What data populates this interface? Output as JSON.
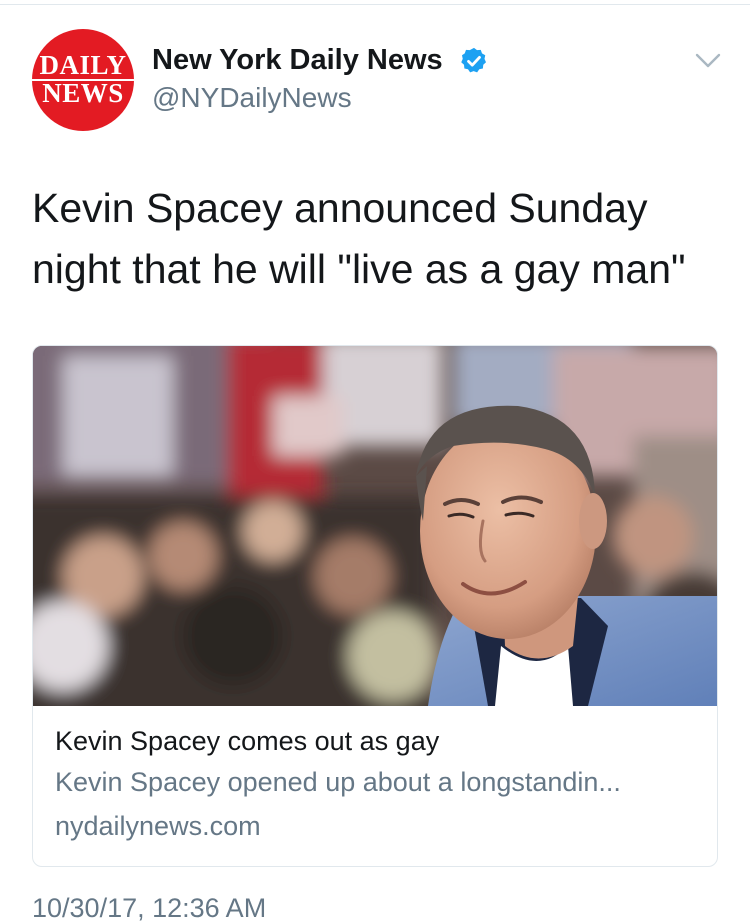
{
  "tweet": {
    "author": {
      "logo_text": [
        "DAILY",
        "NEWS"
      ],
      "name": "New York Daily News",
      "handle": "@NYDailyNews",
      "verified": true
    },
    "text": "Kevin Spacey announced Sunday night that he will \"live as a gay man\"",
    "card": {
      "title": "Kevin Spacey comes out as gay",
      "description": "Kevin Spacey opened up about a longstandin...",
      "domain": "nydailynews.com"
    },
    "timestamp": "10/30/17, 12:36 AM"
  },
  "icons": {
    "verified": "verified-badge-icon",
    "menu": "chevron-down-icon"
  },
  "colors": {
    "logo_red": "#e31b23",
    "verified_blue": "#1da1f2",
    "secondary_text": "#657786",
    "border": "#e1e8ed"
  }
}
